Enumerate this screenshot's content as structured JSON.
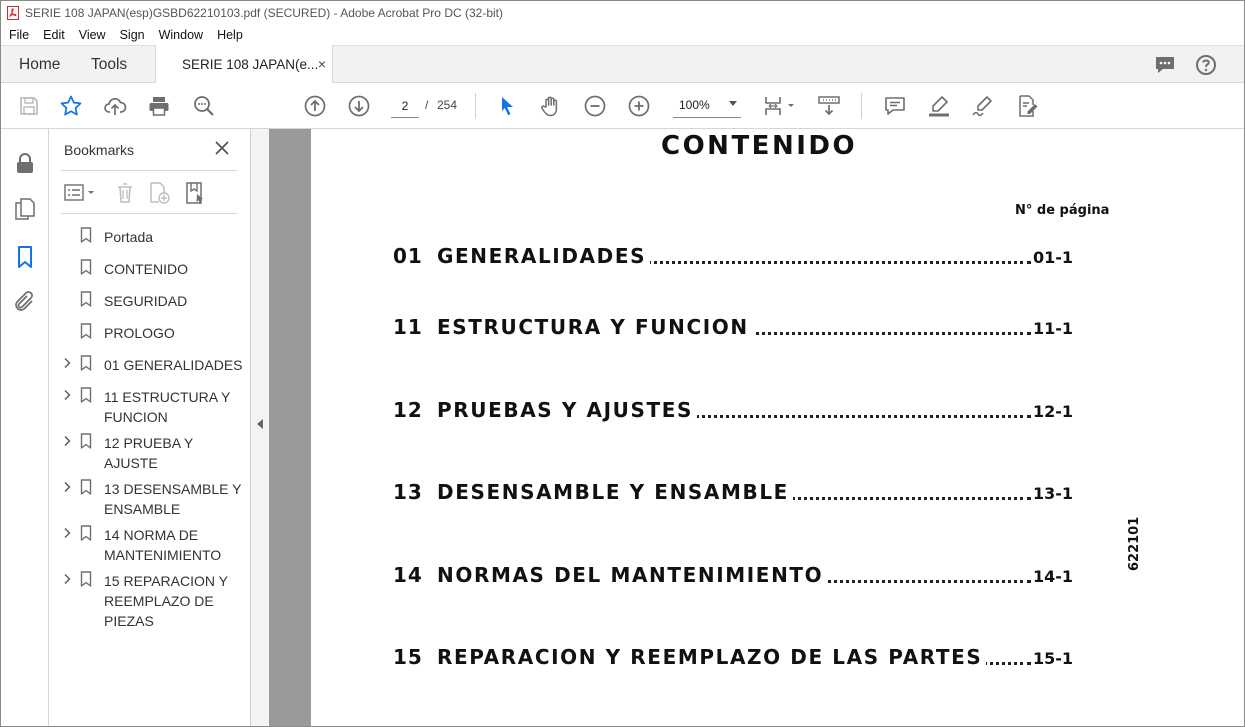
{
  "window": {
    "title": "SERIE 108 JAPAN(esp)GSBD62210103.pdf (SECURED) - Adobe Acrobat Pro DC (32-bit)"
  },
  "menu": [
    "File",
    "Edit",
    "View",
    "Sign",
    "Window",
    "Help"
  ],
  "tabs": {
    "home": "Home",
    "tools": "Tools",
    "document": "SERIE 108 JAPAN(e...",
    "close": "×"
  },
  "toolbar": {
    "page_current": "2",
    "page_separator": "/",
    "page_total": "254",
    "zoom": "100%"
  },
  "bookmarks": {
    "title": "Bookmarks",
    "items": [
      {
        "label": "Portada",
        "expandable": false
      },
      {
        "label": "CONTENIDO",
        "expandable": false
      },
      {
        "label": "SEGURIDAD",
        "expandable": false
      },
      {
        "label": "PROLOGO",
        "expandable": false
      },
      {
        "label": "01 GENERALIDADES",
        "expandable": true
      },
      {
        "label": "11 ESTRUCTURA Y FUNCION",
        "expandable": true
      },
      {
        "label": "12 PRUEBA Y AJUSTE",
        "expandable": true
      },
      {
        "label": "13 DESENSAMBLE Y ENSAMBLE",
        "expandable": true
      },
      {
        "label": "14 NORMA DE MANTENIMIENTO",
        "expandable": true
      },
      {
        "label": "15 REPARACION Y REEMPLAZO DE PIEZAS",
        "expandable": true
      }
    ]
  },
  "document": {
    "title": "CONTENIDO",
    "page_column_header": "N° de página",
    "side_code": "622101",
    "toc": [
      {
        "num": "01",
        "text": "GENERALIDADES",
        "page": "01-1"
      },
      {
        "num": "11",
        "text": "ESTRUCTURA Y FUNCION",
        "page": "11-1"
      },
      {
        "num": "12",
        "text": "PRUEBAS Y AJUSTES",
        "page": "12-1"
      },
      {
        "num": "13",
        "text": "DESENSAMBLE Y ENSAMBLE",
        "page": "13-1"
      },
      {
        "num": "14",
        "text": "NORMAS DEL MANTENIMIENTO",
        "page": "14-1"
      },
      {
        "num": "15",
        "text": "REPARACION Y REEMPLAZO DE LAS PARTES",
        "page": "15-1"
      }
    ]
  },
  "colors": {
    "accent_blue": "#1473e6",
    "acrobat_red": "#d7282f",
    "icon_gray": "#6e6e6e"
  }
}
